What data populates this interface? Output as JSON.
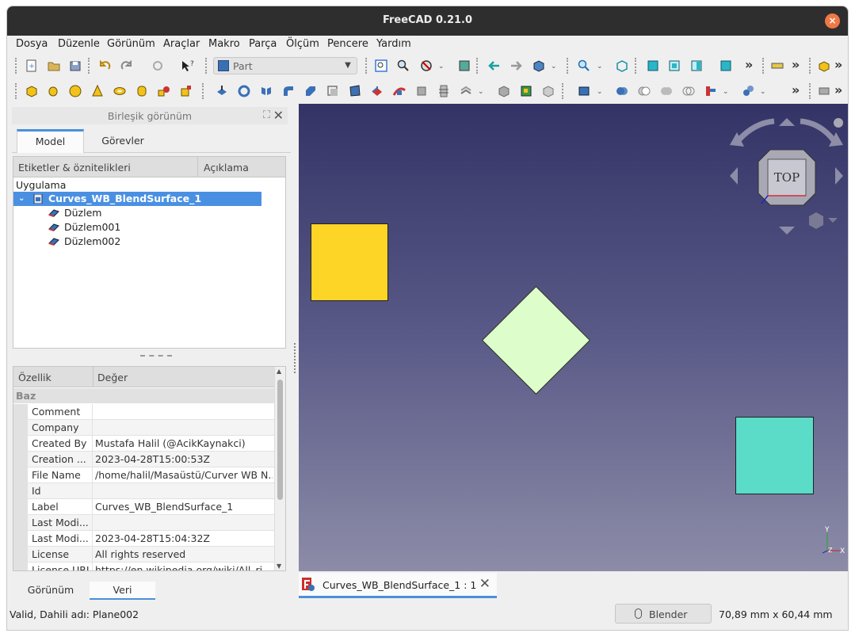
{
  "window": {
    "title": "FreeCAD 0.21.0",
    "close_glyph": "×"
  },
  "menu": [
    "Dosya",
    "Düzenle",
    "Görünüm",
    "Araçlar",
    "Makro",
    "Parça",
    "Ölçüm",
    "Pencere",
    "Yardım"
  ],
  "toolbar": {
    "workbench": "Part",
    "more": "»"
  },
  "combo_view": {
    "title": "Birleşik görünüm",
    "tabs": [
      "Model",
      "Görevler"
    ],
    "tree": {
      "columns": [
        "Etiketler & öznitelikleri",
        "Açıklama"
      ],
      "section": "Uygulama",
      "document": "Curves_WB_BlendSurface_1",
      "children": [
        "Düzlem",
        "Düzlem001",
        "Düzlem002"
      ]
    },
    "properties": {
      "columns": [
        "Özellik",
        "Değer"
      ],
      "group": "Baz",
      "rows": [
        {
          "key": "Comment",
          "value": ""
        },
        {
          "key": "Company",
          "value": ""
        },
        {
          "key": "Created By",
          "value": "Mustafa Halil (@AcikKaynakci)"
        },
        {
          "key": "Creation ...",
          "value": "2023-04-28T15:00:53Z"
        },
        {
          "key": "File Name",
          "value": "/home/halil/Masaüstü/Curver WB N..."
        },
        {
          "key": "Id",
          "value": ""
        },
        {
          "key": "Label",
          "value": "Curves_WB_BlendSurface_1"
        },
        {
          "key": "Last Modi...",
          "value": ""
        },
        {
          "key": "Last Modi...",
          "value": "2023-04-28T15:04:32Z"
        },
        {
          "key": "License",
          "value": "All rights reserved"
        },
        {
          "key": "License URL",
          "value": "https://en.wikipedia.org/wiki/All_ri..."
        }
      ]
    },
    "bottom_tabs": [
      "Görünüm",
      "Veri"
    ]
  },
  "view": {
    "tab_label": "Curves_WB_BlendSurface_1 : 1",
    "navcube_face": "TOP",
    "axis_y": "Y",
    "axis_x": "X",
    "axis_z": "Z",
    "colors": {
      "yellow": "#fcd526",
      "pale_green": "#ddfecb",
      "teal": "#5adcc8"
    }
  },
  "status": {
    "message": "Valid, Dahili adı: Plane002",
    "navigation_style": "Blender",
    "dimensions": "70,89 mm x 60,44 mm"
  }
}
